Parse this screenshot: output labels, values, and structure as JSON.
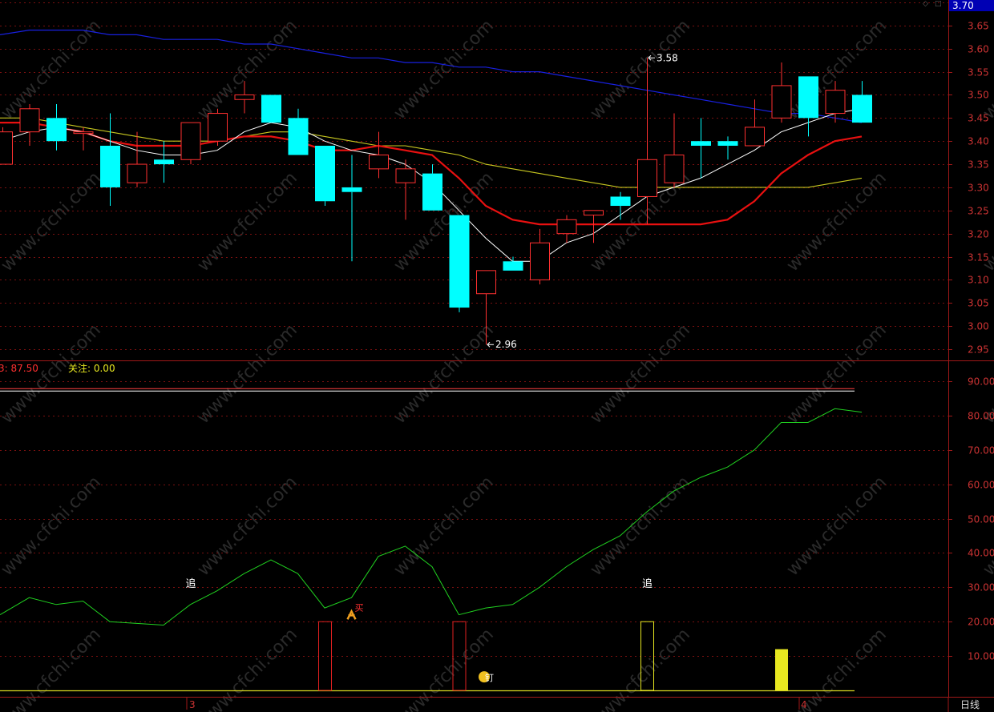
{
  "colors": {
    "background": "#000000",
    "grid": "#7a1010",
    "axis": "#a01818",
    "up": "#ff3030",
    "down": "#00ffff",
    "ma_white": "#ffffff",
    "ma_red": "#e81010",
    "ma_yellow": "#c8c820",
    "ma_blue": "#1820e0",
    "indicator_line": "#20d020",
    "ref_line": "#ff4040",
    "base_line": "#d8d820",
    "signal_red": "#e02020",
    "signal_yellow": "#e8e820",
    "label_red": "#ff3030",
    "label_yellow": "#e8e820"
  },
  "header": {
    "price_badge": "3.70",
    "value_label": "3: 87.50",
    "focus_label": "关注: 0.00"
  },
  "watermark": "www.cfchi.com",
  "footer": {
    "month_1": "3",
    "month_2": "4",
    "period": "日线"
  },
  "chart_data": [
    {
      "type": "candlestick",
      "y_ticks": [
        "3.70",
        "3.65",
        "3.60",
        "3.55",
        "3.50",
        "3.45",
        "3.40",
        "3.35",
        "3.30",
        "3.25",
        "3.20",
        "3.15",
        "3.10",
        "3.05",
        "3.00",
        "2.95"
      ],
      "ylim": [
        2.93,
        3.7
      ],
      "grid": true,
      "candles": [
        {
          "o": 3.35,
          "c": 3.42,
          "h": 3.43,
          "l": 3.35
        },
        {
          "o": 3.42,
          "c": 3.47,
          "h": 3.48,
          "l": 3.39
        },
        {
          "o": 3.45,
          "c": 3.4,
          "h": 3.48,
          "l": 3.38
        },
        {
          "o": 3.42,
          "c": 3.42,
          "h": 3.43,
          "l": 3.38
        },
        {
          "o": 3.39,
          "c": 3.3,
          "h": 3.46,
          "l": 3.26
        },
        {
          "o": 3.31,
          "c": 3.35,
          "h": 3.42,
          "l": 3.3
        },
        {
          "o": 3.36,
          "c": 3.35,
          "h": 3.4,
          "l": 3.31
        },
        {
          "o": 3.36,
          "c": 3.44,
          "h": 3.44,
          "l": 3.35
        },
        {
          "o": 3.4,
          "c": 3.46,
          "h": 3.47,
          "l": 3.39
        },
        {
          "o": 3.49,
          "c": 3.5,
          "h": 3.53,
          "l": 3.46
        },
        {
          "o": 3.5,
          "c": 3.44,
          "h": 3.5,
          "l": 3.44
        },
        {
          "o": 3.45,
          "c": 3.37,
          "h": 3.47,
          "l": 3.37
        },
        {
          "o": 3.39,
          "c": 3.27,
          "h": 3.39,
          "l": 3.26
        },
        {
          "o": 3.3,
          "c": 3.29,
          "h": 3.37,
          "l": 3.14
        },
        {
          "o": 3.34,
          "c": 3.37,
          "h": 3.42,
          "l": 3.32
        },
        {
          "o": 3.31,
          "c": 3.34,
          "h": 3.36,
          "l": 3.23
        },
        {
          "o": 3.33,
          "c": 3.25,
          "h": 3.35,
          "l": 3.25
        },
        {
          "o": 3.24,
          "c": 3.04,
          "h": 3.24,
          "l": 3.03
        },
        {
          "o": 3.07,
          "c": 3.12,
          "h": 3.12,
          "l": 2.96
        },
        {
          "o": 3.14,
          "c": 3.12,
          "h": 3.15,
          "l": 3.12
        },
        {
          "o": 3.1,
          "c": 3.18,
          "h": 3.21,
          "l": 3.09
        },
        {
          "o": 3.2,
          "c": 3.23,
          "h": 3.24,
          "l": 3.18
        },
        {
          "o": 3.24,
          "c": 3.25,
          "h": 3.25,
          "l": 3.18
        },
        {
          "o": 3.28,
          "c": 3.26,
          "h": 3.29,
          "l": 3.23
        },
        {
          "o": 3.28,
          "c": 3.36,
          "h": 3.58,
          "l": 3.22
        },
        {
          "o": 3.31,
          "c": 3.37,
          "h": 3.46,
          "l": 3.3
        },
        {
          "o": 3.4,
          "c": 3.39,
          "h": 3.45,
          "l": 3.32
        },
        {
          "o": 3.4,
          "c": 3.39,
          "h": 3.41,
          "l": 3.36
        },
        {
          "o": 3.39,
          "c": 3.43,
          "h": 3.49,
          "l": 3.39
        },
        {
          "o": 3.45,
          "c": 3.52,
          "h": 3.57,
          "l": 3.44
        },
        {
          "o": 3.54,
          "c": 3.45,
          "h": 3.54,
          "l": 3.41
        },
        {
          "o": 3.46,
          "c": 3.51,
          "h": 3.53,
          "l": 3.44
        },
        {
          "o": 3.5,
          "c": 3.44,
          "h": 3.53,
          "l": 3.44
        }
      ],
      "annotations": [
        {
          "text": "3.58",
          "candle": 24,
          "price": 3.58
        },
        {
          "text": "2.96",
          "candle": 18,
          "price": 2.96
        }
      ],
      "ma_white": [
        3.4,
        3.42,
        3.43,
        3.42,
        3.4,
        3.38,
        3.37,
        3.37,
        3.38,
        3.42,
        3.44,
        3.43,
        3.4,
        3.38,
        3.37,
        3.35,
        3.31,
        3.25,
        3.19,
        3.14,
        3.14,
        3.18,
        3.2,
        3.24,
        3.28,
        3.3,
        3.32,
        3.35,
        3.38,
        3.42,
        3.44,
        3.46,
        3.47
      ],
      "ma_red": [
        3.44,
        3.44,
        3.43,
        3.42,
        3.4,
        3.39,
        3.39,
        3.39,
        3.4,
        3.41,
        3.41,
        3.4,
        3.38,
        3.38,
        3.39,
        3.38,
        3.37,
        3.32,
        3.26,
        3.23,
        3.22,
        3.22,
        3.22,
        3.22,
        3.22,
        3.22,
        3.22,
        3.23,
        3.27,
        3.33,
        3.37,
        3.4,
        3.41
      ],
      "ma_yellow": [
        3.45,
        3.45,
        3.44,
        3.43,
        3.42,
        3.41,
        3.4,
        3.4,
        3.4,
        3.41,
        3.42,
        3.42,
        3.41,
        3.4,
        3.39,
        3.39,
        3.38,
        3.37,
        3.35,
        3.34,
        3.33,
        3.32,
        3.31,
        3.3,
        3.3,
        3.3,
        3.3,
        3.3,
        3.3,
        3.3,
        3.3,
        3.31,
        3.32
      ],
      "ma_blue": [
        3.63,
        3.64,
        3.64,
        3.64,
        3.63,
        3.63,
        3.62,
        3.62,
        3.62,
        3.61,
        3.61,
        3.6,
        3.59,
        3.58,
        3.58,
        3.57,
        3.57,
        3.56,
        3.56,
        3.55,
        3.55,
        3.54,
        3.53,
        3.52,
        3.51,
        3.5,
        3.49,
        3.48,
        3.47,
        3.46,
        3.46,
        3.45,
        3.44
      ]
    },
    {
      "type": "line",
      "y_ticks": [
        "90.00",
        "80.00",
        "70.00",
        "60.00",
        "50.00",
        "40.00",
        "30.00",
        "20.00",
        "10.00"
      ],
      "ylim": [
        0,
        98
      ],
      "grid": true,
      "reference_value": 87.5,
      "series": [
        {
          "values": [
            22,
            27,
            25,
            26,
            20,
            19.5,
            19,
            25,
            29,
            34,
            38,
            34,
            24,
            27,
            39,
            42,
            36,
            22,
            24,
            25,
            30,
            36,
            41,
            45,
            52,
            58,
            62,
            65,
            70,
            78,
            78,
            82,
            81
          ]
        }
      ],
      "bars": [
        {
          "candle": 12,
          "value": 20,
          "style": "red-outline"
        },
        {
          "candle": 17,
          "value": 20,
          "style": "red-outline"
        },
        {
          "candle": 24,
          "value": 20,
          "style": "yellow-outline"
        },
        {
          "candle": 29,
          "value": 12,
          "style": "yellow-filled"
        }
      ],
      "signals": [
        {
          "text": "追",
          "candle": 7,
          "value": 31
        },
        {
          "text": "追",
          "candle": 24,
          "value": 31
        },
        {
          "text": "买",
          "candle": 13,
          "value": 23
        },
        {
          "text": "钉",
          "candle": 18,
          "value": 3
        }
      ]
    }
  ]
}
